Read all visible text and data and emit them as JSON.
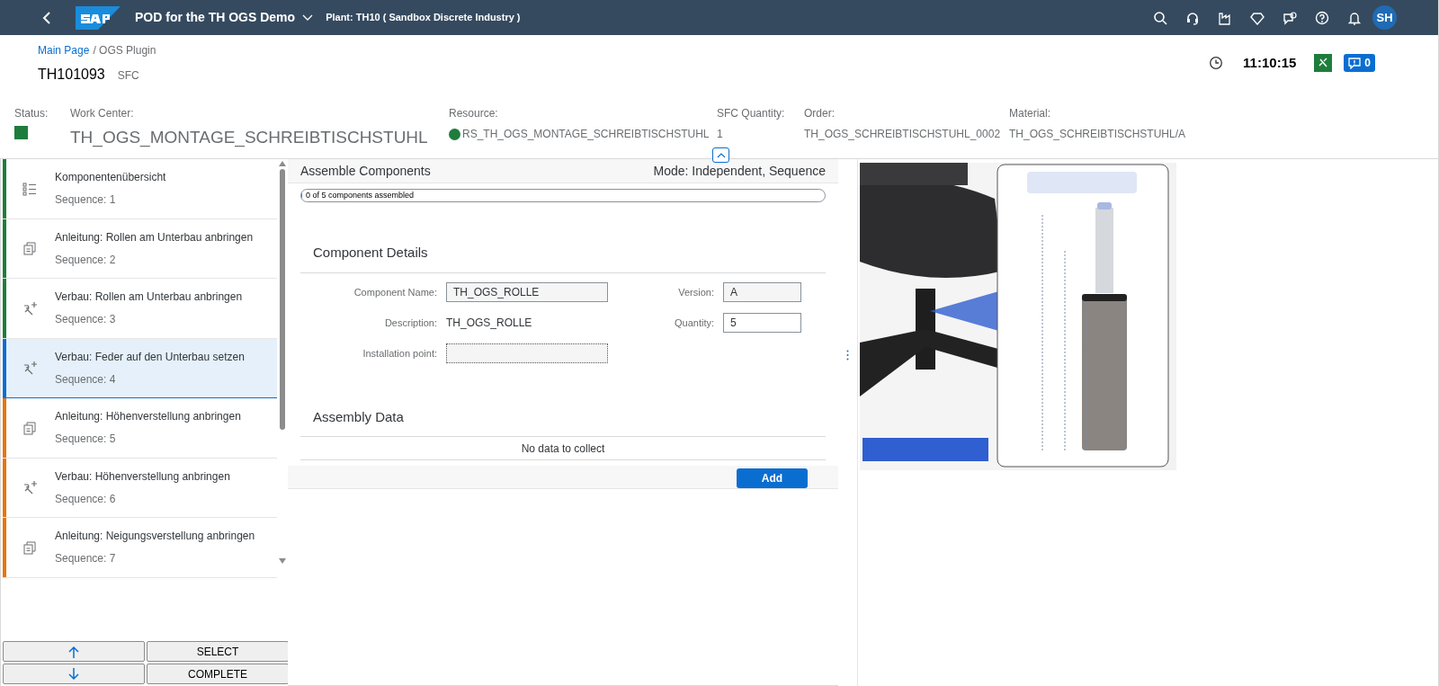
{
  "shell_bar": {
    "title": "POD for the TH OGS Demo",
    "plant": "Plant: TH10 ( Sandbox Discrete Industry )",
    "avatar": "SH"
  },
  "header": {
    "breadcrumb_link": "Main Page",
    "breadcrumb_current": "/ OGS Plugin",
    "title": "TH101093",
    "subtitle": "SFC",
    "time": "11:10:15",
    "notification_count": "0"
  },
  "fields": [
    {
      "kind": "status",
      "label": "Status:",
      "color": "#1e7d3c"
    },
    {
      "kind": "large",
      "label": "Work Center:",
      "value": "TH_OGS_MONTAGE_SCHREIBTISCHSTUHL"
    },
    {
      "kind": "dot",
      "label": "Resource:",
      "value": "RS_TH_OGS_MONTAGE_SCHREIBTISCHSTUHL",
      "color": "#1e7d3c"
    },
    {
      "kind": "text",
      "label": "SFC Quantity:",
      "value": "1"
    },
    {
      "kind": "text",
      "label": "Order:",
      "value": "TH_OGS_SCHREIBTISCHSTUHL_0002"
    },
    {
      "kind": "text",
      "label": "Material:",
      "value": "TH_OGS_SCHREIBTISCHSTUHL/A"
    }
  ],
  "steps": [
    {
      "kind": "list",
      "title": "Komponentenübersicht",
      "sequence": "Sequence: 1",
      "color": "#1e7d3c",
      "selected": false
    },
    {
      "kind": "document",
      "title": "Anleitung: Rollen am Unterbau anbringen",
      "sequence": "Sequence: 2",
      "color": "#1e7d3c",
      "selected": false
    },
    {
      "kind": "assemble",
      "title": "Verbau: Rollen am Unterbau anbringen",
      "sequence": "Sequence: 3",
      "color": "#1e7d3c",
      "selected": false
    },
    {
      "kind": "assemble",
      "title": "Verbau: Feder auf den Unterbau setzen",
      "sequence": "Sequence: 4",
      "color": "#0a6ed1",
      "selected": true
    },
    {
      "kind": "document",
      "title": "Anleitung: Höhenverstellung anbringen",
      "sequence": "Sequence: 5",
      "color": "#e9730c",
      "selected": false
    },
    {
      "kind": "assemble",
      "title": "Verbau: Höhenverstellung anbringen",
      "sequence": "Sequence: 6",
      "color": "#e9730c",
      "selected": false
    },
    {
      "kind": "document",
      "title": "Anleitung: Neigungsverstellung anbringen",
      "sequence": "Sequence: 7",
      "color": "#e9730c",
      "selected": false
    }
  ],
  "step_buttons": {
    "select": "SELECT",
    "complete": "COMPLETE"
  },
  "assemble": {
    "title": "Assemble Components",
    "mode": "Mode: Independent, Sequence",
    "progress_text": "0 of 5 components assembled",
    "level": 0,
    "details_title": "Component Details",
    "component_name_label": "Component Name:",
    "component_name": "TH_OGS_ROLLE",
    "version_label": "Version:",
    "version": "A",
    "description_label": "Description:",
    "description": "TH_OGS_ROLLE",
    "quantity_label": "Quantity:",
    "quantity": "5",
    "installation_label": "Installation point:",
    "data_title": "Assembly Data",
    "no_data": "No data to collect",
    "add_button": "Add"
  }
}
